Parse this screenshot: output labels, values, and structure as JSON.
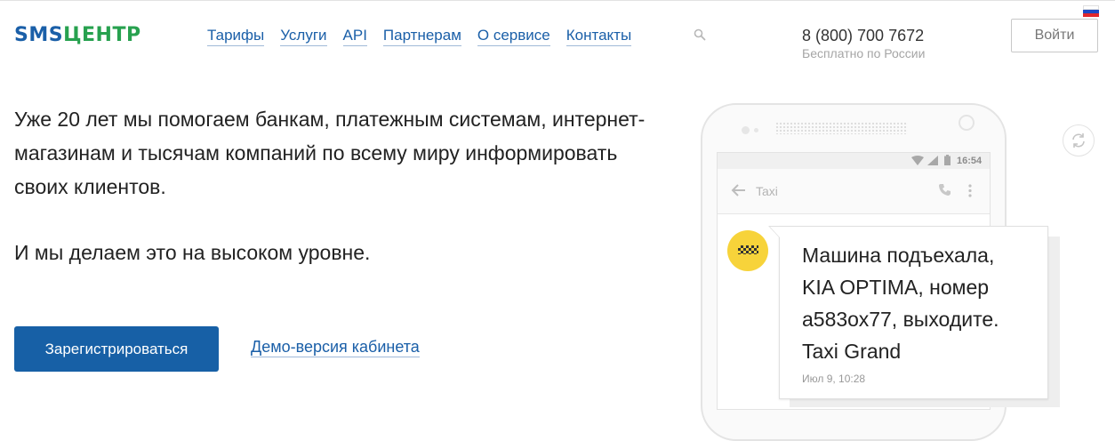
{
  "header": {
    "logo": {
      "part1": "SMS",
      "part2": "ЦЕНТР"
    },
    "nav": [
      {
        "label": "Тарифы"
      },
      {
        "label": "Услуги"
      },
      {
        "label": "API"
      },
      {
        "label": "Партнерам"
      },
      {
        "label": "О сервисе"
      },
      {
        "label": "Контакты"
      }
    ],
    "search_icon": "search-icon",
    "phone": "8 (800) 700 7672",
    "phone_note": "Бесплатно по России",
    "login_label": "Войти",
    "language_flag": "russian-flag"
  },
  "hero": {
    "headline": "Уже 20 лет мы помогаем банкам, платежным системам, интернет-магазинам и тысячам компаний по всему миру информировать своих клиентов.",
    "subline": "И мы делаем это на высоком уровне.",
    "register_label": "Зарегистрироваться",
    "demo_label": "Демо-версия кабинета"
  },
  "phone_mockup": {
    "status_time": "16:54",
    "app_title": "Taxi",
    "message_text": "Машина подъехала,\nKIA OPTIMA, номер\nа583ох77, выходите.\nTaxi Grand",
    "message_time": "Июл 9, 10:28"
  },
  "colors": {
    "brand_blue": "#1760a6",
    "brand_green": "#27a14f",
    "link": "#1a5fa8",
    "avatar_yellow": "#f7d33a"
  }
}
